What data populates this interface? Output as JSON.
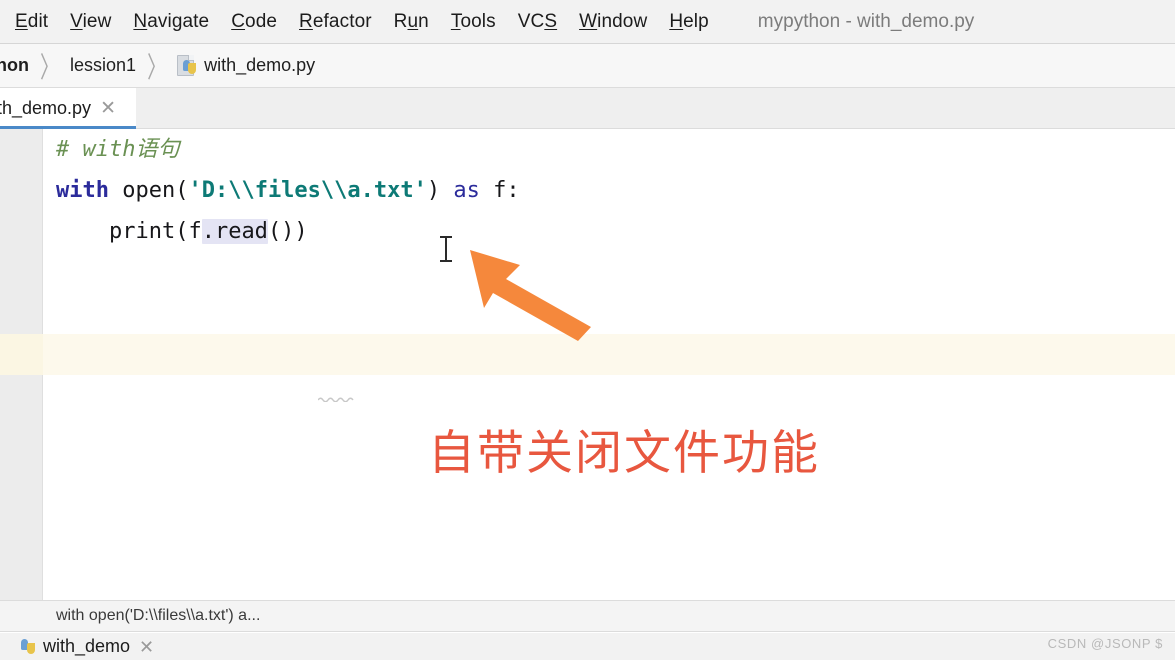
{
  "window": {
    "title": "mypython - with_demo.py"
  },
  "menubar": {
    "items": [
      {
        "name": "edit",
        "pre": "",
        "mn": "E",
        "post": "dit"
      },
      {
        "name": "view",
        "pre": "",
        "mn": "V",
        "post": "iew"
      },
      {
        "name": "navigate",
        "pre": "",
        "mn": "N",
        "post": "avigate"
      },
      {
        "name": "code",
        "pre": "",
        "mn": "C",
        "post": "ode"
      },
      {
        "name": "refactor",
        "pre": "",
        "mn": "R",
        "post": "efactor"
      },
      {
        "name": "run",
        "pre": "R",
        "mn": "u",
        "post": "n"
      },
      {
        "name": "tools",
        "pre": "",
        "mn": "T",
        "post": "ools"
      },
      {
        "name": "vcs",
        "pre": "VC",
        "mn": "S",
        "post": ""
      },
      {
        "name": "window",
        "pre": "",
        "mn": "W",
        "post": "indow"
      },
      {
        "name": "help",
        "pre": "",
        "mn": "H",
        "post": "elp"
      }
    ],
    "labels": {
      "edit": "Edit",
      "view": "View",
      "navigate": "Navigate",
      "code": "Code",
      "refactor": "Refactor",
      "run": "Run",
      "tools": "Tools",
      "vcs": "VCS",
      "window": "Window",
      "help": "Help"
    }
  },
  "breadcrumb": {
    "project": "non",
    "folder": "lession1",
    "file": "with_demo.py",
    "separator": "〉",
    "file_icon": "python-file-icon"
  },
  "editor_tabs": {
    "active": {
      "label": "ith_demo.py",
      "close": "✕"
    }
  },
  "code": {
    "line1": {
      "comment": "# with语句"
    },
    "line2": {
      "kw_with": "with",
      "space1": " ",
      "func": "open(",
      "string": "'D:\\\\files\\\\a.txt'",
      "close_paren": ")",
      "space2": " ",
      "kw_as": "as",
      "space3": " ",
      "var": "f:"
    },
    "line3": {
      "indent": "    ",
      "print_call": "print(f",
      "selected": ".read",
      "tail": "())"
    }
  },
  "annotation": {
    "note_text": "自带关闭文件功能",
    "note_color": "#e8573f",
    "arrow_color": "#f5883c",
    "arrow_name": "orange-pointer-arrow"
  },
  "status": {
    "text": "with open('D:\\\\files\\\\a.txt') a..."
  },
  "bottom": {
    "run_tab_label": "with_demo",
    "run_tab_close": "✕",
    "run_tab_icon": "python-icon"
  },
  "watermark": {
    "text": "CSDN @JSONP $"
  },
  "colors": {
    "accent_tab": "#4a89c8",
    "line_highlight": "#fdf9ec",
    "selection": "#e4e4f4",
    "comment": "#6a9153",
    "keyword": "#2b2b9b",
    "string": "#0d7a76",
    "annotation": "#e8573f",
    "arrow": "#f5883c"
  }
}
